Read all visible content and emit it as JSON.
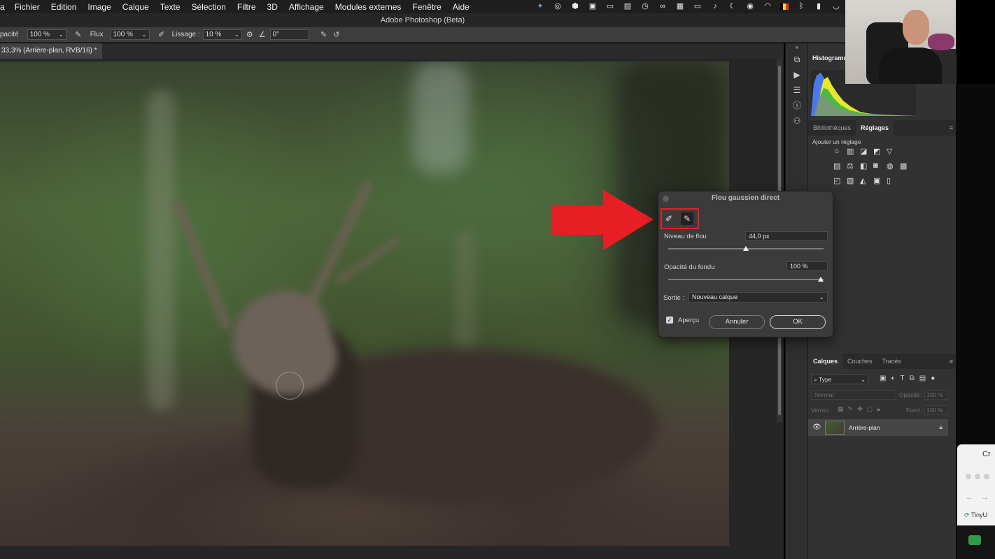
{
  "menubar": {
    "app_letter": "a",
    "items": [
      "Fichier",
      "Edition",
      "Image",
      "Calque",
      "Texte",
      "Sélection",
      "Filtre",
      "3D",
      "Affichage",
      "Modules externes",
      "Fenêtre",
      "Aide"
    ]
  },
  "window_title": "Adobe Photoshop (Beta)",
  "options_bar": {
    "opacity_label": "pacité",
    "opacity_value": "100 %",
    "flux_label": "Flux",
    "flux_value": "100 %",
    "lissage_label": "Lissage :",
    "lissage_value": "10 %",
    "angle_value": "0°"
  },
  "document_tab": "33,3% (Arrière-plan, RVB/16) *",
  "panels": {
    "histogram_title": "Histogramm",
    "tabs_top": [
      "Bibliothèques",
      "Réglages"
    ],
    "add_adjustment": "Ajouter un réglage",
    "layers_tabs": [
      "Calques",
      "Couches",
      "Tracés"
    ],
    "filter_type": "Type",
    "blend_mode": "Normal",
    "opacity_label": "Opacité :",
    "opacity_value": "100 %",
    "lock_label": "Verrou :",
    "fill_label": "Fond :",
    "fill_value": "100 %",
    "layer_name": "Arrière-plan"
  },
  "dialog": {
    "title": "Flou gaussien direct",
    "blur_label": "Niveau de flou",
    "blur_value": "44,0 px",
    "blur_fraction": 0.5,
    "fade_label": "Opacité du fondu",
    "fade_value": "100 %",
    "fade_fraction": 1.0,
    "output_label": "Sortie :",
    "output_value": "Nouveau calque",
    "preview_label": "Aperçu",
    "preview_checked": true,
    "cancel_label": "Annuler",
    "ok_label": "OK"
  },
  "browser_peek": {
    "title_fragment": "Cr",
    "tab_fragment": "TinyU"
  },
  "colors": {
    "highlight_red": "#e81e25"
  }
}
